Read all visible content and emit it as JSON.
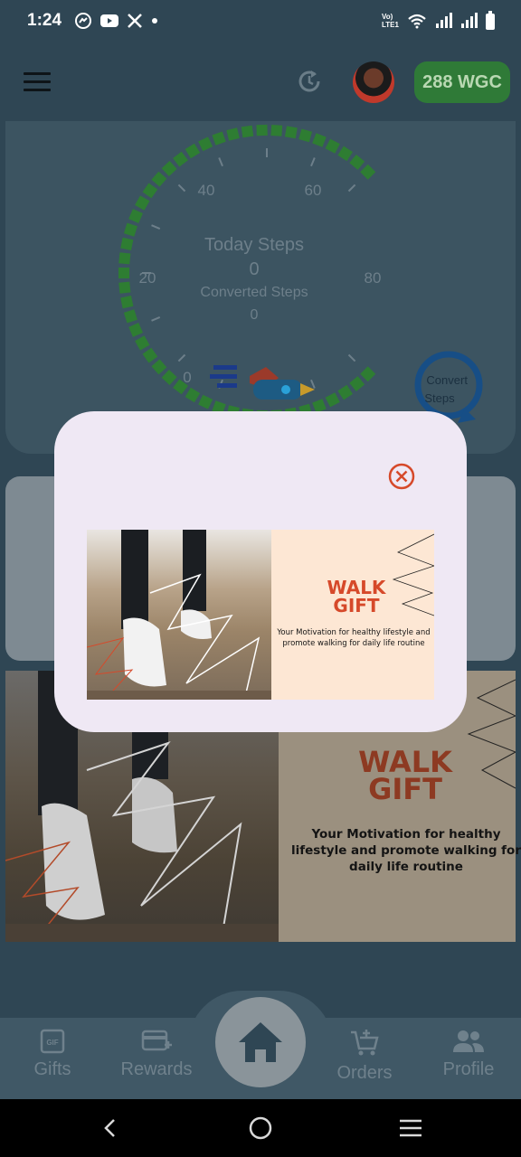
{
  "status_bar": {
    "time": "1:24",
    "left_icons": [
      "messenger-icon",
      "youtube-icon",
      "x-icon",
      "dot-icon"
    ],
    "right_icons": [
      "volte-icon",
      "wifi-icon",
      "signal-icon",
      "signal-icon",
      "battery-icon"
    ],
    "volte_label": "Vo) LTE1"
  },
  "app_bar": {
    "menu_icon": "hamburger-icon",
    "refresh_icon": "refresh-icon",
    "balance": "288 WGC"
  },
  "gauge": {
    "title": "Today Steps",
    "today_steps": "0",
    "converted_label": "Converted Steps",
    "converted_steps": "0",
    "tick_labels": [
      "0",
      "20",
      "40",
      "60",
      "80"
    ],
    "convert_button": "Convert Steps",
    "accent_color": "#2e7d32"
  },
  "banner": {
    "title_line1": "WALK",
    "title_line2": "GIFT",
    "text": "Your Motivation for healthy lifestyle and promote walking for daily life routine"
  },
  "bottom_nav": {
    "items": [
      {
        "label": "Gifts",
        "icon": "gif-icon"
      },
      {
        "label": "Rewards",
        "icon": "card-add-icon"
      },
      {
        "label": "Orders",
        "icon": "cart-add-icon"
      },
      {
        "label": "Profile",
        "icon": "people-icon"
      }
    ],
    "home_icon": "home-icon"
  },
  "popup": {
    "close_icon": "close-circle-icon",
    "banner_title_line1": "WALK",
    "banner_title_line2": "GIFT",
    "banner_text": "Your Motivation for healthy lifestyle and promote walking for daily life routine",
    "accent_color": "#d6492a"
  }
}
